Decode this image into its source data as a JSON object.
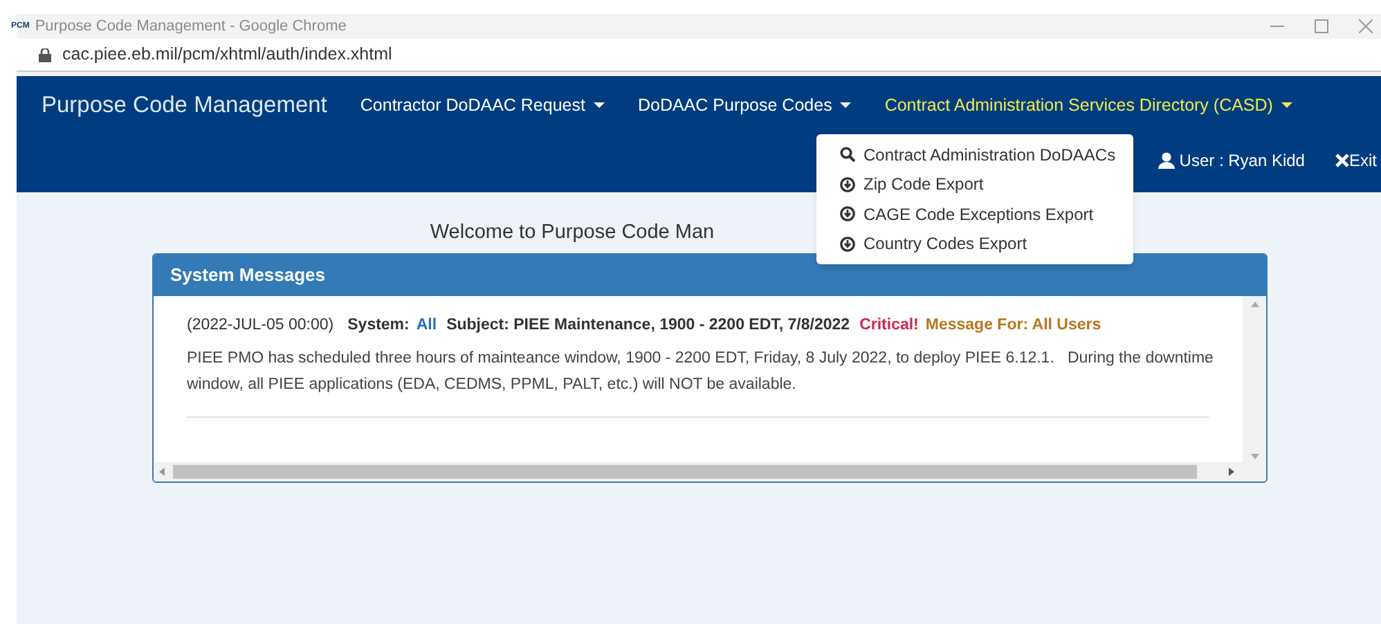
{
  "window": {
    "title": "Purpose Code Management - Google Chrome",
    "app_badge": "PCM"
  },
  "address_bar": {
    "url": "cac.piee.eb.mil/pcm/xhtml/auth/index.xhtml"
  },
  "navbar": {
    "brand": "Purpose Code Management",
    "menus": [
      {
        "label": "Contractor DoDAAC Request",
        "selected": false
      },
      {
        "label": "DoDAAC Purpose Codes",
        "selected": false
      },
      {
        "label": "Contract Administration Services Directory (CASD)",
        "selected": true
      }
    ],
    "user": "User : Ryan Kidd",
    "exit": "Exit"
  },
  "dropdown": [
    {
      "label": "Contract Administration DoDAACs",
      "kind": "search"
    },
    {
      "label": "Zip Code Export",
      "kind": "download"
    },
    {
      "label": "CAGE Code Exceptions Export",
      "kind": "download"
    },
    {
      "label": "Country Codes Export",
      "kind": "download"
    }
  ],
  "welcome": "Welcome to Purpose Code Man",
  "system_messages": {
    "title": "System Messages",
    "messages": [
      {
        "header": [
          {
            "text": "(2022-JUL-05 00:00)",
            "kind": "date"
          },
          {
            "text": "System:",
            "kind": "label"
          },
          {
            "text": "All",
            "kind": "value"
          },
          {
            "text": "Subject: PIEE Maintenance, 1900 - 2200 EDT, 7/8/2022",
            "kind": "label"
          },
          {
            "text": "Critical!",
            "kind": "critical"
          },
          {
            "text": "Message For: All Users",
            "kind": "audience"
          }
        ],
        "body_lines": [
          "PIEE PMO has scheduled three hours of mainteance window, 1900 - 2200 EDT, Friday, 8 July 2022, to deploy PIEE 6.12.1.   During the downtime",
          "window, all PIEE applications (EDA, CEDMS, PPML, PALT, etc.) will NOT be available."
        ]
      }
    ]
  }
}
